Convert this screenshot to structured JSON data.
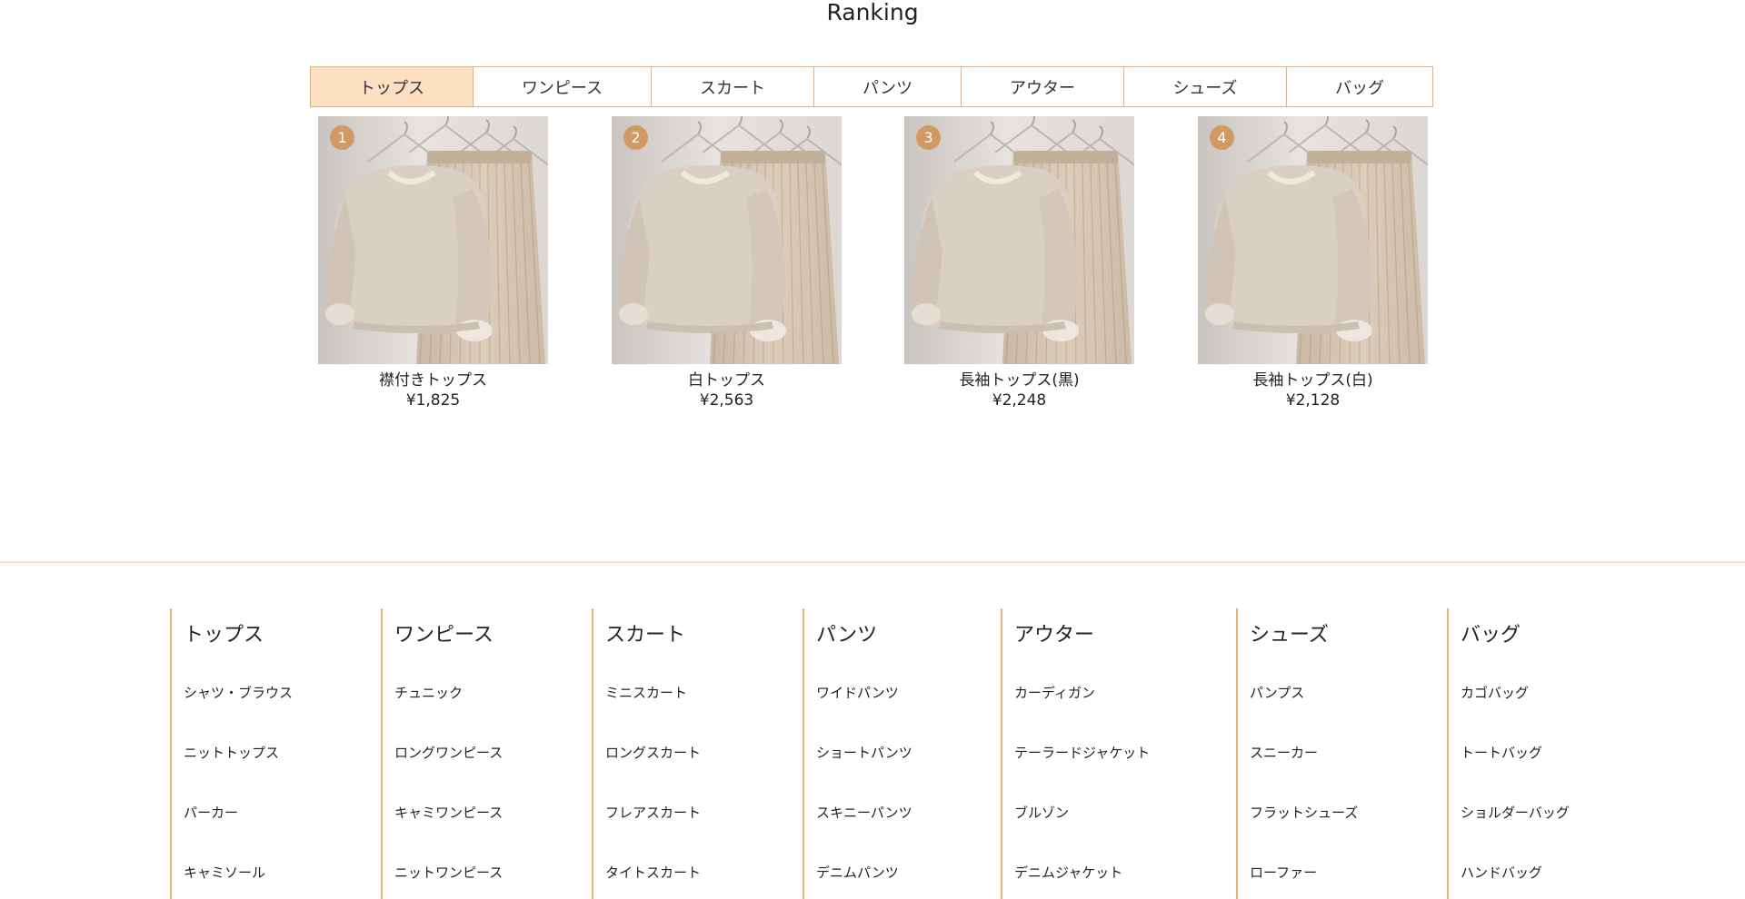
{
  "ranking": {
    "title": "Ranking"
  },
  "tabs": [
    {
      "label": "トップス",
      "active": true
    },
    {
      "label": "ワンピース",
      "active": false
    },
    {
      "label": "スカート",
      "active": false
    },
    {
      "label": "パンツ",
      "active": false
    },
    {
      "label": "アウター",
      "active": false
    },
    {
      "label": "シューズ",
      "active": false
    },
    {
      "label": "バッグ",
      "active": false
    }
  ],
  "products": [
    {
      "rank": "1",
      "name": "襟付きトップス",
      "price": "¥1,825"
    },
    {
      "rank": "2",
      "name": "白トップス",
      "price": "¥2,563"
    },
    {
      "rank": "3",
      "name": "長袖トップス(黒)",
      "price": "¥2,248"
    },
    {
      "rank": "4",
      "name": "長袖トップス(白)",
      "price": "¥2,128"
    }
  ],
  "footer": {
    "columns": [
      {
        "heading": "トップス",
        "items": [
          "シャツ・ブラウス",
          "ニットトップス",
          "パーカー",
          "キャミソール"
        ]
      },
      {
        "heading": "ワンピース",
        "items": [
          "チュニック",
          "ロングワンピース",
          "キャミワンピース",
          "ニットワンピース"
        ]
      },
      {
        "heading": "スカート",
        "items": [
          "ミニスカート",
          "ロングスカート",
          "フレアスカート",
          "タイトスカート"
        ]
      },
      {
        "heading": "パンツ",
        "items": [
          "ワイドパンツ",
          "ショートパンツ",
          "スキニーパンツ",
          "デニムパンツ"
        ]
      },
      {
        "heading": "アウター",
        "items": [
          "カーディガン",
          "テーラードジャケット",
          "ブルゾン",
          "デニムジャケット"
        ]
      },
      {
        "heading": "シューズ",
        "items": [
          "パンプス",
          "スニーカー",
          "フラットシューズ",
          "ローファー"
        ]
      },
      {
        "heading": "バッグ",
        "items": [
          "カゴバッグ",
          "トートバッグ",
          "ショルダーバッグ",
          "ハンドバッグ"
        ]
      }
    ]
  },
  "colors": {
    "accent": "#e9ae74",
    "active_tab_bg": "#fce0bf",
    "badge": "#d29a62"
  }
}
